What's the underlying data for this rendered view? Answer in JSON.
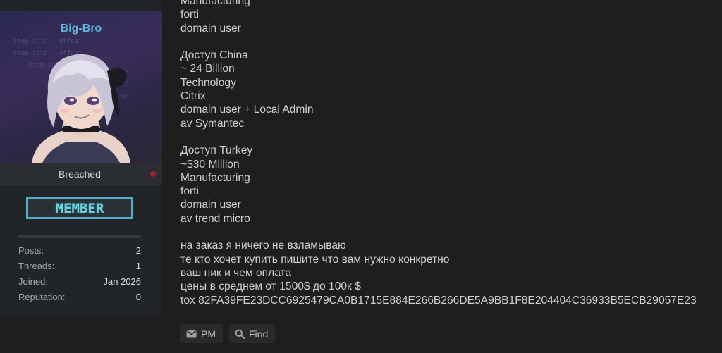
{
  "user": {
    "username": "Big-Bro",
    "rank": "Breached",
    "badge": "MEMBER",
    "stats": [
      {
        "label": "Posts:",
        "value": "2"
      },
      {
        "label": "Threads:",
        "value": "1"
      },
      {
        "label": "Joined:",
        "value": "Jan 2026"
      },
      {
        "label": "Reputation:",
        "value": "0"
      }
    ],
    "status_color": "#a02222"
  },
  "post": {
    "lines": [
      "Manufacturing",
      "forti",
      "domain user",
      "",
      "Доступ China",
      "~ 24 Billion",
      "Technology",
      "Citrix",
      "domain user + Local Admin",
      "av Symantec",
      "",
      "Доступ Turkey",
      "~$30 Million",
      "Manufacturing",
      "forti",
      "domain user",
      "av trend micro",
      "",
      "на заказ я ничего не взламываю",
      "те кто хочет купить пишите что вам нужно конкретно",
      "ваш ник и чем оплата",
      "цены в среднем от 1500$ до 100к $",
      "tox 82FA39FE23DCC6925479CA0B1715E884E266B266DE5A9BB1F8E204404C36933B5ECB29057E23"
    ]
  },
  "actions": {
    "pm_label": "PM",
    "find_label": "Find",
    "pm_icon": "envelope-icon",
    "find_icon": "search-icon"
  }
}
